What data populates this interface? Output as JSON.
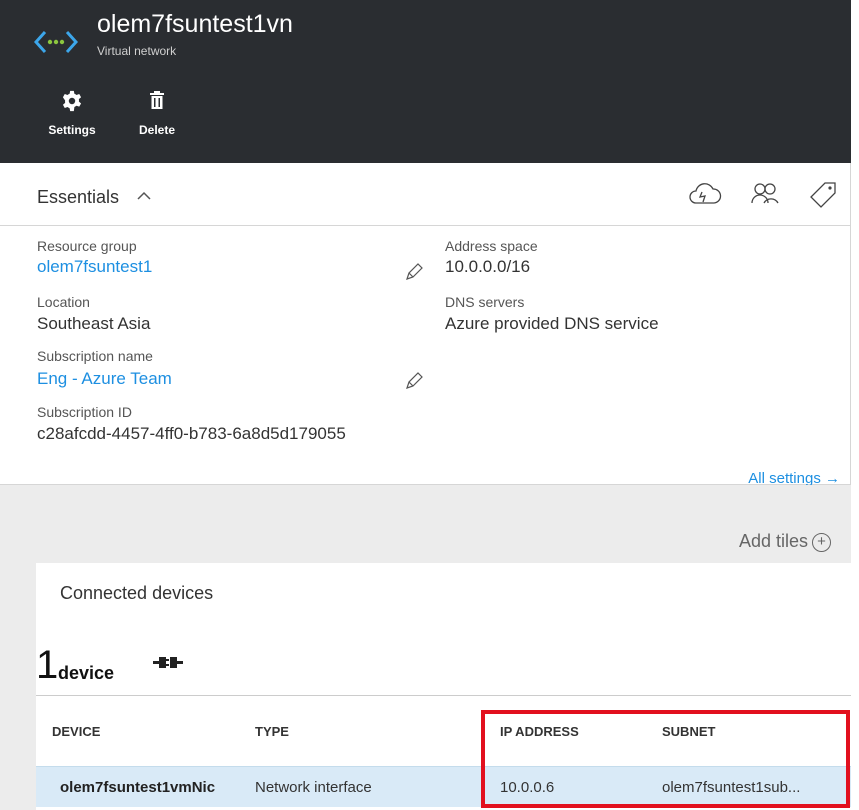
{
  "header": {
    "title": "olem7fsuntest1vn",
    "subtitle": "Virtual network",
    "commands": [
      {
        "label": "Settings",
        "icon": "gear-icon"
      },
      {
        "label": "Delete",
        "icon": "trash-icon"
      }
    ]
  },
  "essentials": {
    "title": "Essentials",
    "chevron": "^",
    "tool_icons": [
      "cloud-quickstart-icon",
      "users-icon",
      "tag-icon"
    ],
    "left": [
      {
        "label": "Resource group",
        "value": "olem7fsuntest1",
        "link": true,
        "editable": true
      },
      {
        "label": "Location",
        "value": "Southeast Asia",
        "link": false,
        "editable": false
      },
      {
        "label": "Subscription name",
        "value": "Eng - Azure Team",
        "link": true,
        "editable": true
      },
      {
        "label": "Subscription ID",
        "value": "c28afcdd-4457-4ff0-b783-6a8d5d179055",
        "link": false,
        "editable": false
      }
    ],
    "right": [
      {
        "label": "Address space",
        "value": "10.0.0.0/16"
      },
      {
        "label": "DNS servers",
        "value": "Azure provided DNS service"
      }
    ],
    "all_settings": "All settings →"
  },
  "tiles": {
    "add_tiles": "Add tiles"
  },
  "connected_devices": {
    "title": "Connected devices",
    "count": "1",
    "unit": "device",
    "columns": [
      "DEVICE",
      "TYPE",
      "IP ADDRESS",
      "SUBNET"
    ],
    "rows": [
      {
        "device": "olem7fsuntest1vmNic",
        "type": "Network interface",
        "ip": "10.0.0.6",
        "subnet": "olem7fsuntest1sub..."
      }
    ]
  },
  "colors": {
    "header_bg": "#2a2d31",
    "link": "#1d8fe1",
    "row_selected": "#d9eaf7",
    "highlight": "#e2101e"
  }
}
